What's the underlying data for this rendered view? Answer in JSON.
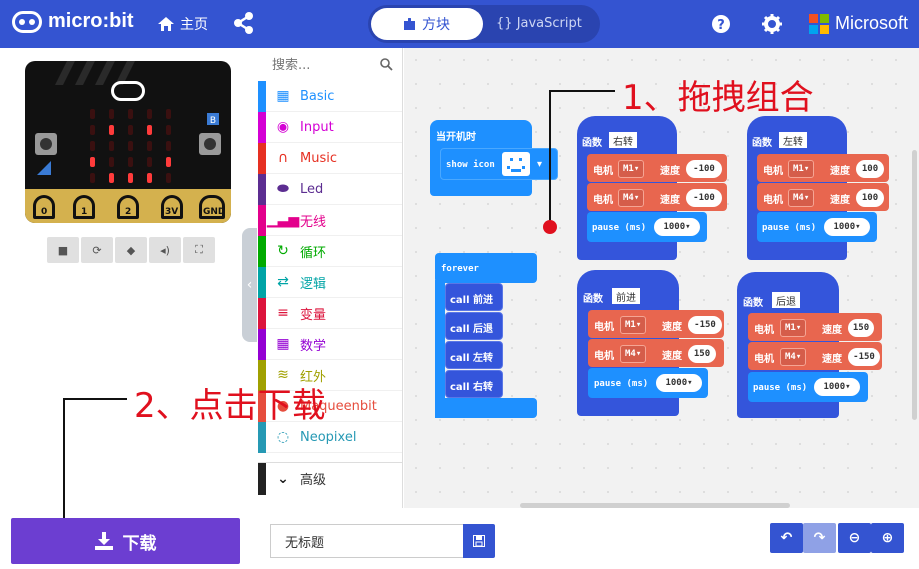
{
  "header": {
    "logo_text": "micro:bit",
    "home_label": "主页",
    "tab_blocks": "方块",
    "tab_js": "JavaScript",
    "brand": "Microsoft"
  },
  "simulator": {
    "pins": [
      "0",
      "1",
      "2",
      "3V",
      "GND"
    ],
    "tool_icons": [
      "stop-icon",
      "restart-icon",
      "slowmo-icon",
      "sound-icon",
      "fullscreen-icon"
    ]
  },
  "toolbox": {
    "search_placeholder": "搜索...",
    "categories": [
      {
        "label": "Basic",
        "color": "#1e90ff",
        "icon": "grid-icon"
      },
      {
        "label": "Input",
        "color": "#d400d4",
        "icon": "target-icon"
      },
      {
        "label": "Music",
        "color": "#e63022",
        "icon": "headphones-icon"
      },
      {
        "label": "Led",
        "color": "#5c2d91",
        "icon": "toggle-icon"
      },
      {
        "label": "无线",
        "color": "#e3008c",
        "icon": "signal-icon"
      },
      {
        "label": "循环",
        "color": "#00aa00",
        "icon": "refresh-icon"
      },
      {
        "label": "逻辑",
        "color": "#00a4a6",
        "icon": "shuffle-icon"
      },
      {
        "label": "变量",
        "color": "#dc143c",
        "icon": "list-icon"
      },
      {
        "label": "数学",
        "color": "#9400d3",
        "icon": "calculator-icon"
      },
      {
        "label": "红外",
        "color": "#a0a000",
        "icon": "wifi-icon"
      },
      {
        "label": "Maqueenbit",
        "color": "#e64d3d",
        "icon": "robot-icon"
      },
      {
        "label": "Neopixel",
        "color": "#2699b4",
        "icon": "ring-icon"
      }
    ],
    "advanced": "高级"
  },
  "workspace": {
    "on_start": {
      "label": "当开机时",
      "show_icon": "show icon"
    },
    "forever": {
      "label": "forever",
      "calls": [
        "call 前进",
        "call 后退",
        "call 左转",
        "call 右转"
      ]
    },
    "functions": [
      {
        "keyword": "函数",
        "name": "右转",
        "m1": "M1",
        "m1_speed": "-100",
        "m2": "M4",
        "m2_speed": "-100",
        "pause": "1000"
      },
      {
        "keyword": "函数",
        "name": "左转",
        "m1": "M1",
        "m1_speed": "100",
        "m2": "M4",
        "m2_speed": "100",
        "pause": "1000"
      },
      {
        "keyword": "函数",
        "name": "前进",
        "m1": "M1",
        "m1_speed": "-150",
        "m2": "M4",
        "m2_speed": "150",
        "pause": "1000"
      },
      {
        "keyword": "函数",
        "name": "后退",
        "m1": "M1",
        "m1_speed": "150",
        "m2": "M4",
        "m2_speed": "-150",
        "pause": "1000"
      }
    ],
    "motor_label": "电机",
    "speed_label": "速度",
    "pause_label": "pause (ms)"
  },
  "annotations": {
    "step1": "1、拖拽组合",
    "step2": "2、点击下载"
  },
  "footer": {
    "download": "下载",
    "project_name": "无标题"
  },
  "colors": {
    "header": "#3454d1",
    "function_block": "#3455db",
    "motor_block": "#e8664f",
    "download": "#6c3ed1",
    "annotation": "#e0101e"
  }
}
